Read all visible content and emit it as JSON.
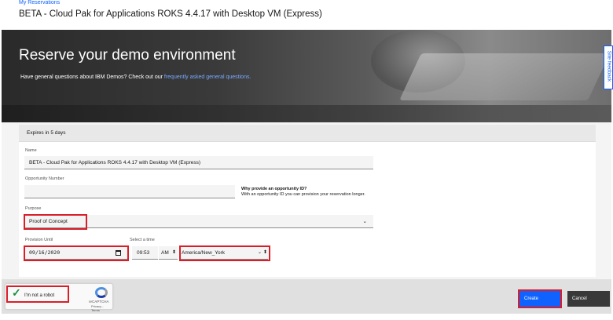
{
  "breadcrumb": {
    "link": "My Reservations"
  },
  "page": {
    "title": "BETA - Cloud Pak for Applications ROKS 4.4.17 with Desktop VM (Express)"
  },
  "hero": {
    "heading": "Reserve your demo environment",
    "subtext": "Have general questions about IBM Demos? Check out our",
    "faq_link": "frequently asked general questions."
  },
  "feedback": {
    "label": "Site feedback"
  },
  "form": {
    "expires": "Expires in 5 days",
    "name": {
      "label": "Name",
      "value": "BETA - Cloud Pak for Applications ROKS 4.4.17 with Desktop VM (Express)"
    },
    "opportunity": {
      "label": "Opportunity Number",
      "value": "",
      "why_title": "Why provide an opportunity ID?",
      "why_desc": "With an opportunity ID you can provision your reservation longer."
    },
    "purpose": {
      "label": "Purpose",
      "value": "Proof of Concept"
    },
    "provision_until": {
      "label": "Provision Until",
      "value": "09/16/2020"
    },
    "time": {
      "label": "Select a time",
      "value": "09:53",
      "ampm": "AM",
      "timezone": "America/New_York"
    }
  },
  "captcha": {
    "label": "I'm not a robot",
    "brand": "reCAPTCHA",
    "links": "Privacy - Terms"
  },
  "actions": {
    "create": "Create",
    "cancel": "Cancel"
  },
  "colors": {
    "accent": "#0f62fe",
    "highlight": "#da1e28",
    "secondary_button": "#393939"
  },
  "icons": [
    "calendar-icon",
    "chevron-down-icon",
    "checkmark-icon",
    "recaptcha-logo-icon"
  ]
}
